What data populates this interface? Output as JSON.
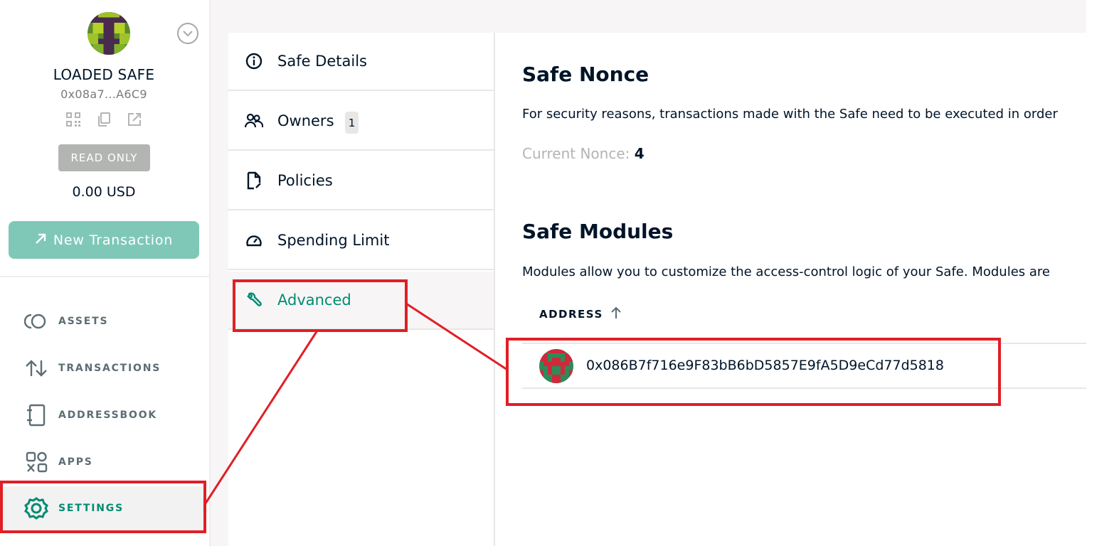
{
  "sidebar": {
    "safe_name": "LOADED SAFE",
    "safe_address": "0x08a7...A6C9",
    "read_only_label": "READ ONLY",
    "balance": "0.00 USD",
    "new_transaction_label": "New Transaction",
    "nav": [
      {
        "label": "ASSETS",
        "icon": "assets-icon"
      },
      {
        "label": "TRANSACTIONS",
        "icon": "transactions-icon"
      },
      {
        "label": "ADDRESSBOOK",
        "icon": "addressbook-icon"
      },
      {
        "label": "APPS",
        "icon": "apps-icon"
      },
      {
        "label": "SETTINGS",
        "icon": "settings-icon",
        "active": true
      }
    ]
  },
  "settings_menu": {
    "items": [
      {
        "label": "Safe Details",
        "icon": "info-icon"
      },
      {
        "label": "Owners",
        "icon": "owners-icon",
        "badge": "1"
      },
      {
        "label": "Policies",
        "icon": "policies-icon"
      },
      {
        "label": "Spending Limit",
        "icon": "speedometer-icon"
      },
      {
        "label": "Advanced",
        "icon": "wrench-icon",
        "active": true
      }
    ]
  },
  "advanced": {
    "nonce_title": "Safe Nonce",
    "nonce_description": "For security reasons, transactions made with the Safe need to be executed in order",
    "current_nonce_label": "Current Nonce:",
    "current_nonce_value": "4",
    "modules_title": "Safe Modules",
    "modules_description": "Modules allow you to customize the access-control logic of your Safe. Modules are",
    "table_header_address": "ADDRESS",
    "modules": [
      {
        "address": "0x086B7f716e9F83bB6bD5857E9fA5D9eCd77d5818"
      }
    ]
  },
  "colors": {
    "accent": "#008c73",
    "button_bg": "#7fc8b8",
    "annotation": "#e01f26",
    "text": "#001428",
    "muted": "#b2b5b2"
  }
}
